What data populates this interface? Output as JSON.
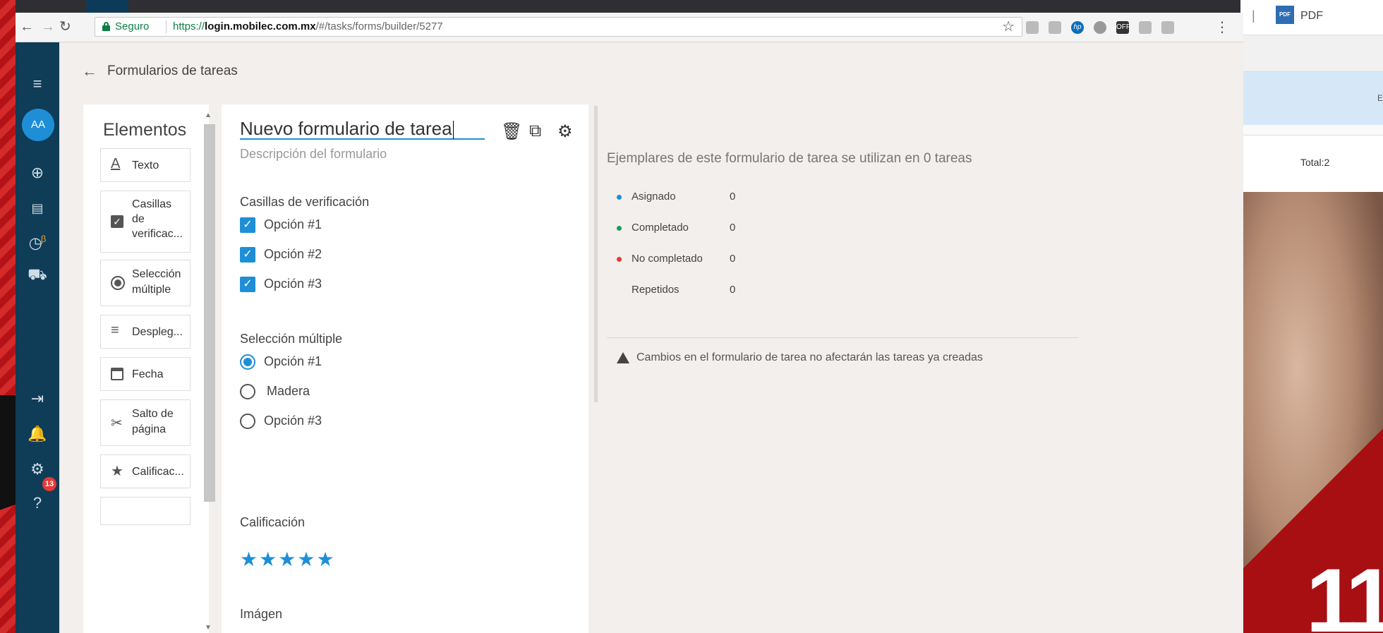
{
  "browser": {
    "secure_label": "Seguro",
    "url_scheme": "https://",
    "url_host": "login.mobilec.com.mx",
    "url_path": "/#/tasks/forms/builder/5277"
  },
  "right_panel": {
    "pdf_label": "PDF",
    "total_label": "Total:2",
    "corner_number": "11"
  },
  "sidebar": {
    "avatar_initials": "AA",
    "beta_mark": "β",
    "notification_count": "13"
  },
  "header": {
    "title": "Formularios de tareas"
  },
  "elements": {
    "title": "Elementos",
    "items": [
      {
        "label": "Texto",
        "icon": "text-icon"
      },
      {
        "label": "Casillas\nde\nverificac...",
        "icon": "checkbox-icon"
      },
      {
        "label": "Selección\nmúltiple",
        "icon": "radio-icon"
      },
      {
        "label": "Despleg...",
        "icon": "dropdown-icon"
      },
      {
        "label": "Fecha",
        "icon": "calendar-icon"
      },
      {
        "label": "Salto de\npágina",
        "icon": "scissors-icon"
      },
      {
        "label": "Calificac...",
        "icon": "star-icon"
      }
    ]
  },
  "form": {
    "title": "Nuevo formulario de tarea",
    "description_placeholder": "Descripción del formulario",
    "checkbox_question": "Casillas de verificación",
    "checkbox_options": [
      "Opción #1",
      "Opción #2",
      "Opción #3"
    ],
    "radio_question": "Selección múltiple",
    "radio_options": [
      "Opción #1",
      "Madera",
      "Opción #3"
    ],
    "radio_selected": 0,
    "rating_question": "Calificación",
    "rating_stars": 5,
    "image_question": "Imágen"
  },
  "info": {
    "usage_text": "Ejemplares de este formulario de tarea se utilizan en 0 tareas",
    "stats": [
      {
        "name": "Asignado",
        "value": "0",
        "color": "#1e8fd6"
      },
      {
        "name": "Completado",
        "value": "0",
        "color": "#1a9e5c"
      },
      {
        "name": "No completado",
        "value": "0",
        "color": "#e53935"
      },
      {
        "name": "Repetidos",
        "value": "0",
        "color": ""
      }
    ],
    "warning": "Cambios en el formulario de tarea no afectarán las tareas ya creadas"
  },
  "colors": {
    "accent": "#1e8fd6",
    "sidebar": "#0f3c57"
  }
}
